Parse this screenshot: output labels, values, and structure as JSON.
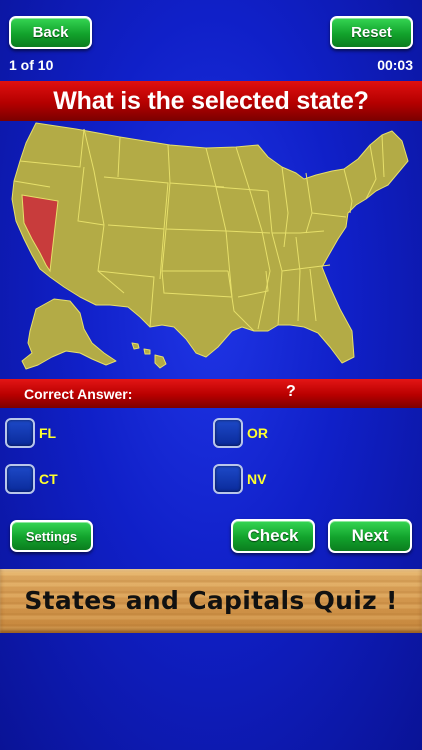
{
  "header": {
    "back_label": "Back",
    "reset_label": "Reset",
    "progress": "1 of 10",
    "timer": "00:03"
  },
  "question": {
    "text": "What is the selected state?"
  },
  "map": {
    "land_color": "#b3ab46",
    "border_color": "#e6df6a",
    "selected_color": "#c83c3c",
    "selected_state": "Nevada"
  },
  "answer": {
    "label": "Correct Answer:",
    "value": "?"
  },
  "options": [
    {
      "label": "FL"
    },
    {
      "label": "OR"
    },
    {
      "label": "CT"
    },
    {
      "label": "NV"
    }
  ],
  "actions": {
    "settings_label": "Settings",
    "check_label": "Check",
    "next_label": "Next"
  },
  "banner": {
    "title": "States and Capitals Quiz !"
  }
}
